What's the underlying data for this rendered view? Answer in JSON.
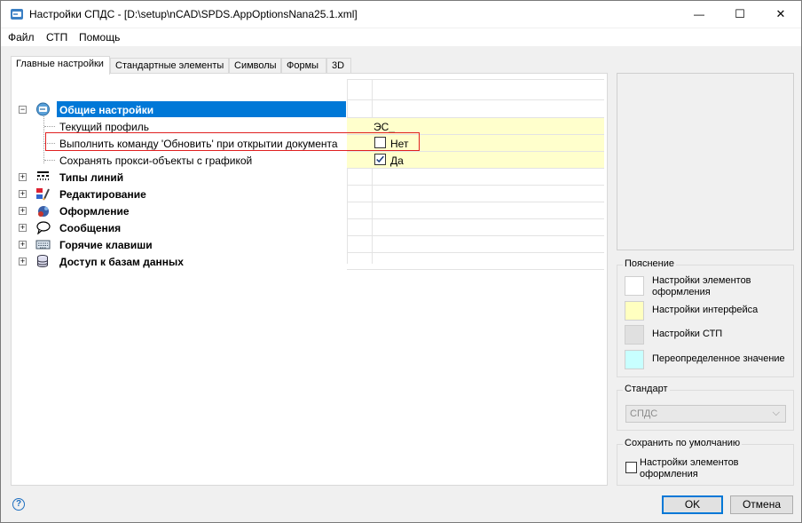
{
  "window": {
    "title": "Настройки СПДС - [D:\\setup\\nCAD\\SPDS.AppOptionsNana25.1.xml]",
    "minimize": "—",
    "maximize": "☐",
    "close": "✕"
  },
  "menu": [
    "Файл",
    "СТП",
    "Помощь"
  ],
  "tabs": [
    "Главные настройки",
    "Стандартные элементы",
    "Символы",
    "Формы",
    "3D"
  ],
  "tree": {
    "general": {
      "label": "Общие настройки",
      "expander": "−",
      "children": [
        {
          "label": "Текущий профиль",
          "value": "ЭС_"
        },
        {
          "label": "Выполнить команду 'Обновить' при открытии документа",
          "value": "Нет",
          "checked": false
        },
        {
          "label": "Сохранять прокси-объекты с графикой",
          "value": "Да",
          "checked": true
        }
      ]
    },
    "nodes": [
      {
        "label": "Типы линий",
        "expander": "+"
      },
      {
        "label": "Редактирование",
        "expander": "+"
      },
      {
        "label": "Оформление",
        "expander": "+"
      },
      {
        "label": "Сообщения",
        "expander": "+"
      },
      {
        "label": "Горячие клавиши",
        "expander": "+"
      },
      {
        "label": "Доступ к базам данных",
        "expander": "+"
      }
    ]
  },
  "legend": {
    "title": "Пояснение",
    "items": [
      {
        "label": "Настройки элементов оформления",
        "color": "#ffffff"
      },
      {
        "label": "Настройки интерфейса",
        "color": "#ffffc0"
      },
      {
        "label": "Настройки СТП",
        "color": "#e0e0e0"
      },
      {
        "label": "Переопределенное значение",
        "color": "#c8ffff"
      }
    ]
  },
  "standard": {
    "title": "Стандарт",
    "value": "СПДС",
    "arrow": "⌵"
  },
  "save_default": {
    "title": "Сохранить по умолчанию",
    "checkbox_label": "Настройки элементов оформления",
    "checked": false
  },
  "buttons": {
    "ok": "OK",
    "cancel": "Отмена",
    "help": "?"
  },
  "colors": {
    "selection": "#0078d7",
    "interface_setting": "#ffffcc",
    "highlight_box": "#e02020"
  }
}
